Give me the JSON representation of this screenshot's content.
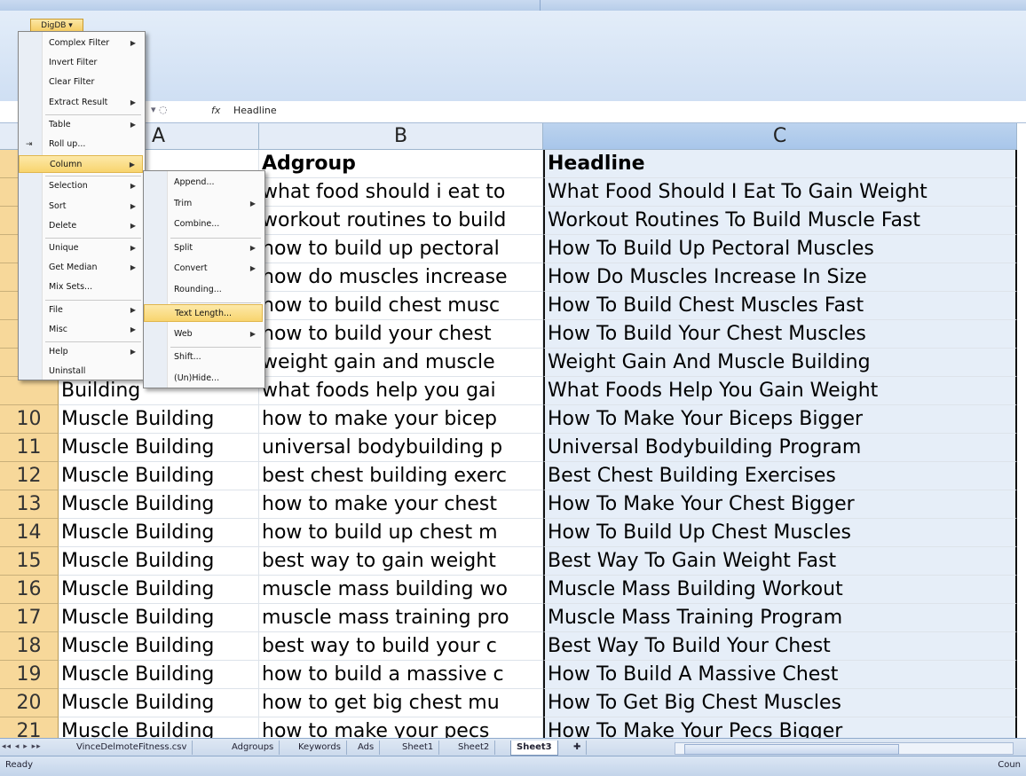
{
  "ribbon": {
    "menu_button": "DigDB ▾"
  },
  "formula_bar": {
    "fx": "fx",
    "value": "Headline"
  },
  "columns": [
    "A",
    "B",
    "C"
  ],
  "grid": {
    "rows": [
      {
        "n": "",
        "a": "",
        "b": "Adgroup",
        "c": "Headline",
        "hdr": true
      },
      {
        "n": "",
        "a": "",
        "b": "what food should i eat to",
        "c": "What Food Should I Eat To Gain Weight"
      },
      {
        "n": "",
        "a": "",
        "b": "workout routines to build",
        "c": "Workout Routines To Build Muscle Fast"
      },
      {
        "n": "",
        "a": "",
        "b": "how to build up pectoral",
        "c": "How To Build Up Pectoral Muscles"
      },
      {
        "n": "",
        "a": "",
        "b": "how do muscles increase",
        "c": "How Do Muscles Increase In Size"
      },
      {
        "n": "",
        "a": "",
        "b": "how to build chest musc",
        "c": "How To Build Chest Muscles Fast"
      },
      {
        "n": "",
        "a": "",
        "b": "how to build your chest",
        "c": "How To Build Your Chest Muscles"
      },
      {
        "n": "",
        "a": "",
        "b": "weight gain and muscle",
        "c": "Weight Gain And Muscle Building"
      },
      {
        "n": "",
        "a": "Building",
        "b": "what foods help you gai",
        "c": "What Foods Help You Gain Weight"
      },
      {
        "n": "10",
        "a": "Muscle Building",
        "b": "how to make your bicep",
        "c": "How To Make Your Biceps Bigger"
      },
      {
        "n": "11",
        "a": "Muscle Building",
        "b": "universal bodybuilding p",
        "c": "Universal Bodybuilding Program"
      },
      {
        "n": "12",
        "a": "Muscle Building",
        "b": "best chest building exerc",
        "c": "Best Chest Building Exercises"
      },
      {
        "n": "13",
        "a": "Muscle Building",
        "b": "how to make your chest",
        "c": "How To Make Your Chest Bigger"
      },
      {
        "n": "14",
        "a": "Muscle Building",
        "b": "how to build up chest m",
        "c": "How To Build Up Chest Muscles"
      },
      {
        "n": "15",
        "a": "Muscle Building",
        "b": "best way to gain weight",
        "c": "Best Way To Gain Weight Fast"
      },
      {
        "n": "16",
        "a": "Muscle Building",
        "b": "muscle mass building wo",
        "c": "Muscle Mass Building Workout"
      },
      {
        "n": "17",
        "a": "Muscle Building",
        "b": "muscle mass training pro",
        "c": "Muscle Mass Training Program"
      },
      {
        "n": "18",
        "a": "Muscle Building",
        "b": "best way to build your c",
        "c": "Best Way To Build Your Chest"
      },
      {
        "n": "19",
        "a": "Muscle Building",
        "b": "how to build a massive c",
        "c": "How To Build A Massive Chest"
      },
      {
        "n": "20",
        "a": "Muscle Building",
        "b": "how to get big chest mu",
        "c": "How To Get Big Chest Muscles"
      },
      {
        "n": "21",
        "a": "Muscle Building",
        "b": "how to make your pecs",
        "c": "How To Make Your Pecs Bigger"
      }
    ]
  },
  "menu_main": {
    "items": [
      {
        "label": "Complex Filter",
        "sub": true
      },
      {
        "label": "Invert Filter"
      },
      {
        "label": "Clear Filter"
      },
      {
        "label": "Extract Result",
        "sub": true
      },
      {
        "label": "Table",
        "sub": true
      },
      {
        "label": "Roll up...",
        "check": "⇥"
      },
      {
        "label": "Column",
        "sub": true,
        "highlight": true
      },
      {
        "label": "Selection",
        "sub": true
      },
      {
        "label": "Sort",
        "sub": true
      },
      {
        "label": "Delete",
        "sub": true
      },
      {
        "label": "Unique",
        "sub": true
      },
      {
        "label": "Get Median",
        "sub": true
      },
      {
        "label": "Mix Sets..."
      },
      {
        "label": "File",
        "sub": true
      },
      {
        "label": "Misc",
        "sub": true
      },
      {
        "label": "Help",
        "sub": true
      },
      {
        "label": "Uninstall"
      }
    ]
  },
  "menu_column": {
    "items": [
      {
        "label": "Append..."
      },
      {
        "label": "Trim",
        "sub": true
      },
      {
        "label": "Combine..."
      },
      {
        "label": "Split",
        "sub": true
      },
      {
        "label": "Convert",
        "sub": true
      },
      {
        "label": "Rounding..."
      },
      {
        "label": "Text Length...",
        "highlight": true
      },
      {
        "label": "Web",
        "sub": true
      },
      {
        "label": "Shift..."
      },
      {
        "label": "(Un)Hide..."
      }
    ]
  },
  "sheet_tabs": {
    "nav": "◂◂ ◂ ▸ ▸▸",
    "tabs": [
      "VinceDelmoteFitness.csv",
      "Adgroups",
      "Keywords",
      "Ads",
      "Sheet1",
      "Sheet2",
      "Sheet3"
    ],
    "active": "Sheet3"
  },
  "status": {
    "left": "Ready",
    "right": "Coun"
  }
}
